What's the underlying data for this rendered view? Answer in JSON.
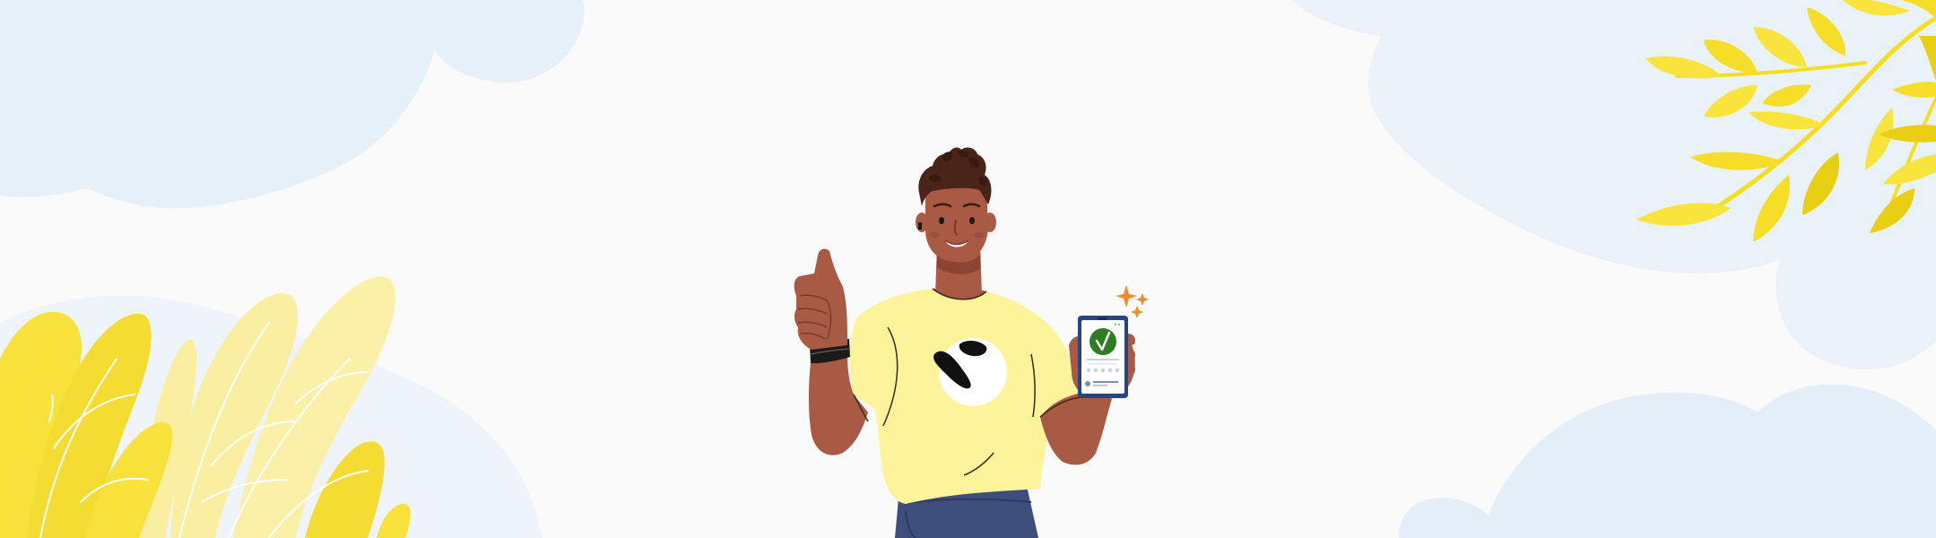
{
  "scene": {
    "description_free": true,
    "palette": {
      "background": "#fafafa",
      "cloud": "#e6f0f8",
      "cloud_deep": "#d7e8f5",
      "leaf_yellow": "#f7e13a",
      "leaf_pale": "#faeea0",
      "branch_yellow": "#f5dd20",
      "skin": "#a95a45",
      "skin_shadow": "#8c4432",
      "hair": "#4a2418",
      "shirt": "#fdf39a",
      "pants": "#3d4e7c",
      "phone_frame": "#27467f",
      "check_green": "#2e7d22",
      "sparkle": "#f08c2a"
    },
    "icons": [
      "thumbs-up-hand-icon",
      "phone-check-icon",
      "sparkle-icon"
    ]
  }
}
